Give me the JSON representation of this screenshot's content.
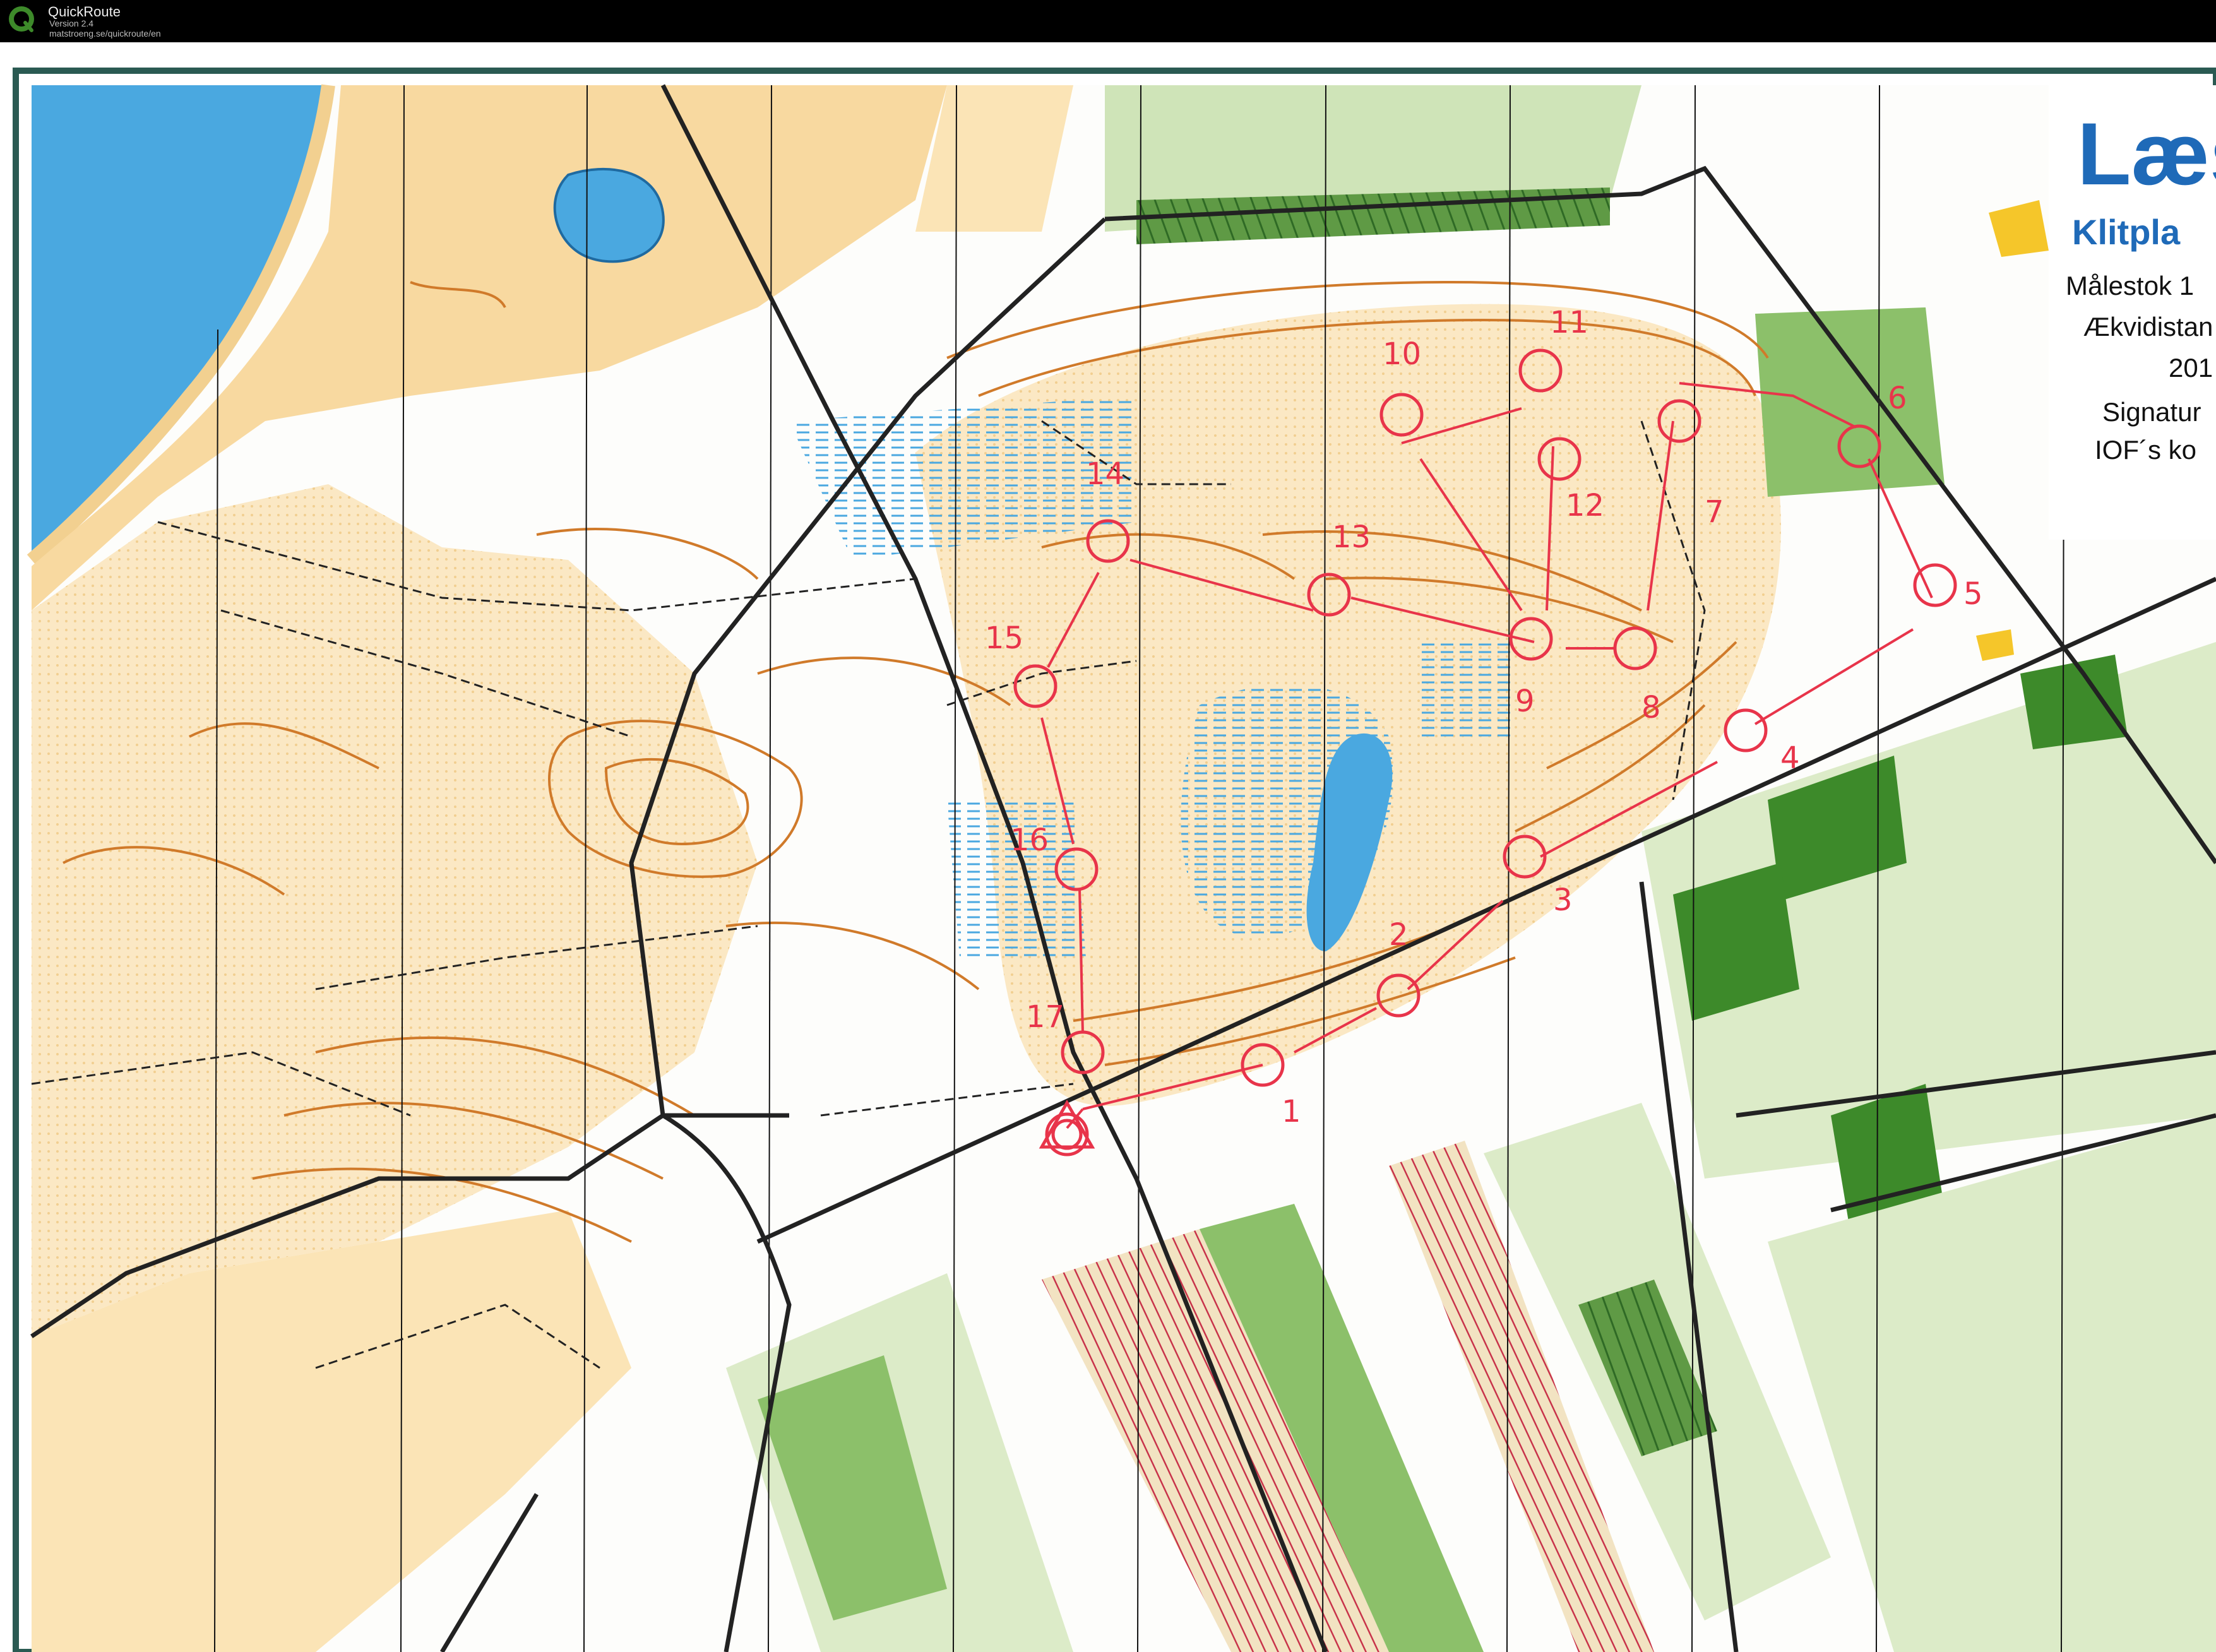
{
  "app": {
    "title": "QuickRoute",
    "version": "Version 2.4",
    "url": "matstroeng.se/quickroute/en"
  },
  "map": {
    "title_fragment": "Læs",
    "subtitle_fragment": "Klitpla",
    "info_lines": [
      "Målestok 1",
      "Ækvidistan",
      "201",
      "Signatur",
      "IOF´s ko"
    ],
    "colors": {
      "open_land": "#f8d9a0",
      "forest": "#ffffff",
      "green": "#8cc06a",
      "water": "#4aa8e0",
      "contours": "#d07a2a",
      "course": "#e8344a",
      "roads": "#222222",
      "out_of_bounds": "#c8334a"
    }
  },
  "course": {
    "start_label": "start-triangle",
    "controls": [
      {
        "label": "1"
      },
      {
        "label": "2"
      },
      {
        "label": "3"
      },
      {
        "label": "4"
      },
      {
        "label": "5"
      },
      {
        "label": "6"
      },
      {
        "label": "7"
      },
      {
        "label": "8"
      },
      {
        "label": "9"
      },
      {
        "label": "10"
      },
      {
        "label": "11"
      },
      {
        "label": "12"
      },
      {
        "label": "13"
      },
      {
        "label": "14"
      },
      {
        "label": "15"
      },
      {
        "label": "16"
      },
      {
        "label": "17"
      }
    ]
  }
}
